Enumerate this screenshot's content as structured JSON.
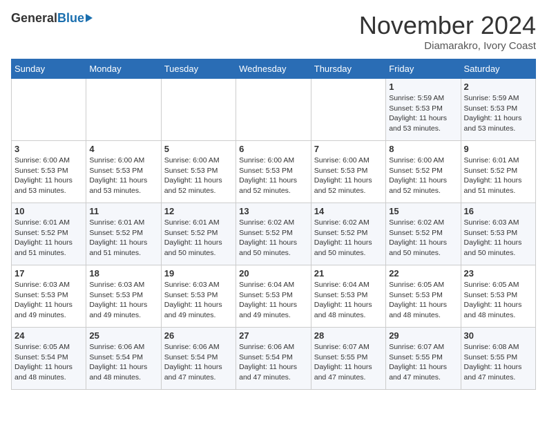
{
  "logo": {
    "general": "General",
    "blue": "Blue"
  },
  "header": {
    "month": "November 2024",
    "location": "Diamarakro, Ivory Coast"
  },
  "weekdays": [
    "Sunday",
    "Monday",
    "Tuesday",
    "Wednesday",
    "Thursday",
    "Friday",
    "Saturday"
  ],
  "weeks": [
    [
      {
        "day": "",
        "info": ""
      },
      {
        "day": "",
        "info": ""
      },
      {
        "day": "",
        "info": ""
      },
      {
        "day": "",
        "info": ""
      },
      {
        "day": "",
        "info": ""
      },
      {
        "day": "1",
        "info": "Sunrise: 5:59 AM\nSunset: 5:53 PM\nDaylight: 11 hours\nand 53 minutes."
      },
      {
        "day": "2",
        "info": "Sunrise: 5:59 AM\nSunset: 5:53 PM\nDaylight: 11 hours\nand 53 minutes."
      }
    ],
    [
      {
        "day": "3",
        "info": "Sunrise: 6:00 AM\nSunset: 5:53 PM\nDaylight: 11 hours\nand 53 minutes."
      },
      {
        "day": "4",
        "info": "Sunrise: 6:00 AM\nSunset: 5:53 PM\nDaylight: 11 hours\nand 53 minutes."
      },
      {
        "day": "5",
        "info": "Sunrise: 6:00 AM\nSunset: 5:53 PM\nDaylight: 11 hours\nand 52 minutes."
      },
      {
        "day": "6",
        "info": "Sunrise: 6:00 AM\nSunset: 5:53 PM\nDaylight: 11 hours\nand 52 minutes."
      },
      {
        "day": "7",
        "info": "Sunrise: 6:00 AM\nSunset: 5:53 PM\nDaylight: 11 hours\nand 52 minutes."
      },
      {
        "day": "8",
        "info": "Sunrise: 6:00 AM\nSunset: 5:52 PM\nDaylight: 11 hours\nand 52 minutes."
      },
      {
        "day": "9",
        "info": "Sunrise: 6:01 AM\nSunset: 5:52 PM\nDaylight: 11 hours\nand 51 minutes."
      }
    ],
    [
      {
        "day": "10",
        "info": "Sunrise: 6:01 AM\nSunset: 5:52 PM\nDaylight: 11 hours\nand 51 minutes."
      },
      {
        "day": "11",
        "info": "Sunrise: 6:01 AM\nSunset: 5:52 PM\nDaylight: 11 hours\nand 51 minutes."
      },
      {
        "day": "12",
        "info": "Sunrise: 6:01 AM\nSunset: 5:52 PM\nDaylight: 11 hours\nand 50 minutes."
      },
      {
        "day": "13",
        "info": "Sunrise: 6:02 AM\nSunset: 5:52 PM\nDaylight: 11 hours\nand 50 minutes."
      },
      {
        "day": "14",
        "info": "Sunrise: 6:02 AM\nSunset: 5:52 PM\nDaylight: 11 hours\nand 50 minutes."
      },
      {
        "day": "15",
        "info": "Sunrise: 6:02 AM\nSunset: 5:52 PM\nDaylight: 11 hours\nand 50 minutes."
      },
      {
        "day": "16",
        "info": "Sunrise: 6:03 AM\nSunset: 5:53 PM\nDaylight: 11 hours\nand 50 minutes."
      }
    ],
    [
      {
        "day": "17",
        "info": "Sunrise: 6:03 AM\nSunset: 5:53 PM\nDaylight: 11 hours\nand 49 minutes."
      },
      {
        "day": "18",
        "info": "Sunrise: 6:03 AM\nSunset: 5:53 PM\nDaylight: 11 hours\nand 49 minutes."
      },
      {
        "day": "19",
        "info": "Sunrise: 6:03 AM\nSunset: 5:53 PM\nDaylight: 11 hours\nand 49 minutes."
      },
      {
        "day": "20",
        "info": "Sunrise: 6:04 AM\nSunset: 5:53 PM\nDaylight: 11 hours\nand 49 minutes."
      },
      {
        "day": "21",
        "info": "Sunrise: 6:04 AM\nSunset: 5:53 PM\nDaylight: 11 hours\nand 48 minutes."
      },
      {
        "day": "22",
        "info": "Sunrise: 6:05 AM\nSunset: 5:53 PM\nDaylight: 11 hours\nand 48 minutes."
      },
      {
        "day": "23",
        "info": "Sunrise: 6:05 AM\nSunset: 5:53 PM\nDaylight: 11 hours\nand 48 minutes."
      }
    ],
    [
      {
        "day": "24",
        "info": "Sunrise: 6:05 AM\nSunset: 5:54 PM\nDaylight: 11 hours\nand 48 minutes."
      },
      {
        "day": "25",
        "info": "Sunrise: 6:06 AM\nSunset: 5:54 PM\nDaylight: 11 hours\nand 48 minutes."
      },
      {
        "day": "26",
        "info": "Sunrise: 6:06 AM\nSunset: 5:54 PM\nDaylight: 11 hours\nand 47 minutes."
      },
      {
        "day": "27",
        "info": "Sunrise: 6:06 AM\nSunset: 5:54 PM\nDaylight: 11 hours\nand 47 minutes."
      },
      {
        "day": "28",
        "info": "Sunrise: 6:07 AM\nSunset: 5:55 PM\nDaylight: 11 hours\nand 47 minutes."
      },
      {
        "day": "29",
        "info": "Sunrise: 6:07 AM\nSunset: 5:55 PM\nDaylight: 11 hours\nand 47 minutes."
      },
      {
        "day": "30",
        "info": "Sunrise: 6:08 AM\nSunset: 5:55 PM\nDaylight: 11 hours\nand 47 minutes."
      }
    ]
  ]
}
